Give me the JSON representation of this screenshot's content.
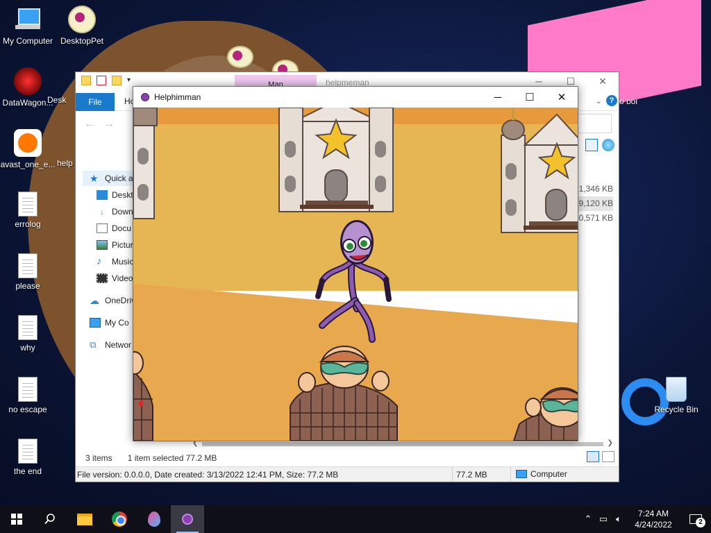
{
  "desktop": {
    "icons": [
      {
        "label": "My Computer",
        "icon": "computer-icon"
      },
      {
        "label": "DesktopPet",
        "icon": "sheep-icon"
      },
      {
        "label": "DataWagon...",
        "icon": "datawagon-icon"
      },
      {
        "label": "Desk",
        "icon": "partial-icon"
      },
      {
        "label": "avast_one_e...",
        "icon": "avast-icon"
      },
      {
        "label": "help",
        "icon": "partial-icon"
      },
      {
        "label": "errolog",
        "icon": "text-file-icon"
      },
      {
        "label": "please",
        "icon": "text-file-icon"
      },
      {
        "label": "why",
        "icon": "text-file-icon"
      },
      {
        "label": "no escape",
        "icon": "text-file-icon"
      },
      {
        "label": "the end",
        "icon": "text-file-icon"
      },
      {
        "label": "Recycle Bin",
        "icon": "recycle-bin-icon"
      },
      {
        "label": "o boi",
        "icon": "partial-icon"
      }
    ]
  },
  "explorer": {
    "context_tab": "Man",
    "title": "helpmeman",
    "ribbon": {
      "file": "File",
      "home": "Ho"
    },
    "nav": [
      {
        "label": "Quick a",
        "icon": "star-icon"
      },
      {
        "label": "Deskto",
        "icon": "desktop-icon"
      },
      {
        "label": "Down",
        "icon": "download-icon"
      },
      {
        "label": "Docu",
        "icon": "document-icon"
      },
      {
        "label": "Pictur",
        "icon": "pictures-icon"
      },
      {
        "label": "Music",
        "icon": "music-icon"
      },
      {
        "label": "Video",
        "icon": "video-icon"
      },
      {
        "label": "OneDriv",
        "icon": "onedrive-icon"
      },
      {
        "label": "My Co",
        "icon": "computer-icon"
      },
      {
        "label": "Networ",
        "icon": "network-icon"
      }
    ],
    "file_sizes": [
      "1,346 KB",
      "9,120 KB",
      "0,571 KB"
    ],
    "status": {
      "items": "3 items",
      "selected": "1 item selected  77.2 MB"
    },
    "details": {
      "info": "File version: 0.0.0.0, Date created: 3/13/2022 12:41 PM, Size: 77.2 MB",
      "size": "77.2 MB",
      "location": "Computer"
    }
  },
  "game": {
    "title": "Helphimman",
    "colors": {
      "sky": "#e69a3c",
      "ground_top": "#e6b655",
      "ground_bottom": "#e8a84e",
      "character": "#8d5bb0"
    }
  },
  "taskbar": {
    "time": "7:24 AM",
    "date": "4/24/2022",
    "notification_count": "2"
  }
}
